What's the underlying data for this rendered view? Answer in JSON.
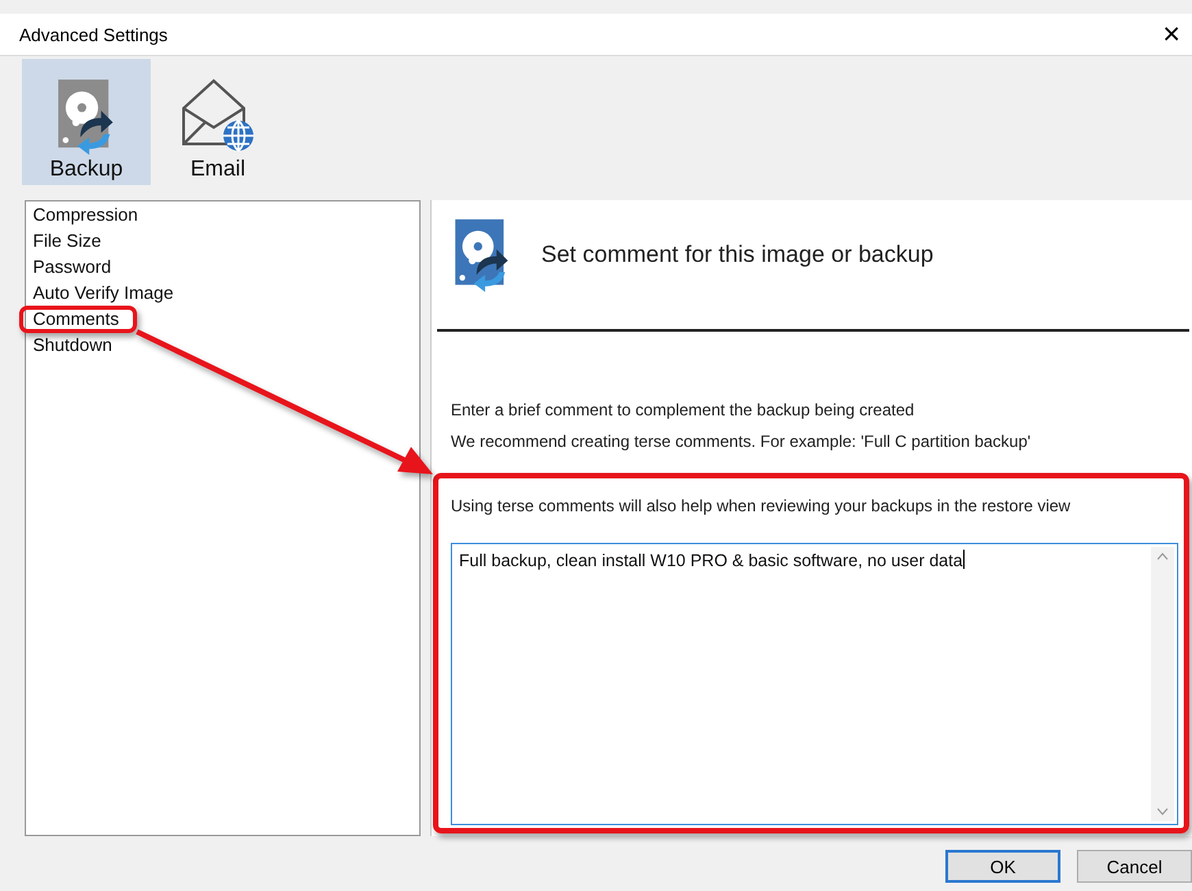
{
  "window": {
    "title": "Advanced Settings",
    "close": "×"
  },
  "tabs": [
    {
      "label": "Backup",
      "selected": true
    },
    {
      "label": "Email",
      "selected": false
    }
  ],
  "sidebar": {
    "items": [
      "Compression",
      "File Size",
      "Password",
      "Auto Verify Image",
      "Comments",
      "Shutdown"
    ]
  },
  "panel": {
    "title": "Set comment for this image or backup",
    "lines": [
      "Enter a brief comment to complement the backup being created",
      "We recommend creating terse comments. For example: 'Full C partition backup'",
      "Using terse comments will also help when reviewing your backups in the restore view"
    ],
    "comment": {
      "value": "Full backup, clean install W10 PRO & basic software, no user data"
    }
  },
  "buttons": [
    {
      "label": "OK",
      "default": true
    },
    {
      "label": "Cancel",
      "default": false
    }
  ]
}
